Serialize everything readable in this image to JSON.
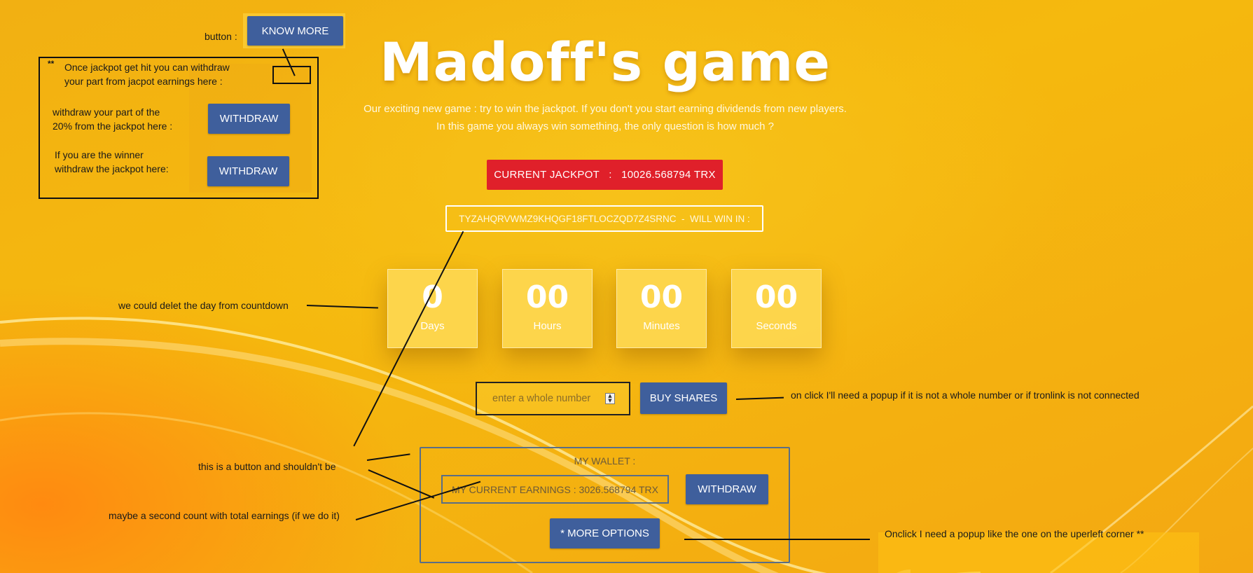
{
  "title": "Madoff's game",
  "subtitle": {
    "line1": "Our exciting new game : try to win the jackpot. If you don't you start earning dividends from new players.",
    "line2": "In this game you always win something, the only question is how much ?"
  },
  "jackpot": {
    "label": "CURRENT JACKPOT   :   10026.568794 TRX"
  },
  "winner": {
    "label": "TYZAHQRVWMZ9KHQGF18FTLOCZQD7Z4SRNC  -  WILL WIN IN :"
  },
  "countdown": [
    {
      "value": "0",
      "label": "Days"
    },
    {
      "value": "00",
      "label": "Hours"
    },
    {
      "value": "00",
      "label": "Minutes"
    },
    {
      "value": "00",
      "label": "Seconds"
    }
  ],
  "buy": {
    "placeholder": "enter a whole number",
    "button": "BUY SHARES"
  },
  "wallet": {
    "heading": "MY WALLET :",
    "earnings": "MY CURRENT EARNINGS : 3026.568794 TRX",
    "withdraw": "WITHDRAW",
    "more_options": "* MORE OPTIONS"
  },
  "top_left": {
    "button_note": "button :",
    "know_more": "KNOW MORE",
    "stars": "**",
    "jackpot_note_line1": "Once jackpot get hit you can withdraw",
    "jackpot_note_line2": "your part from jacpot earnings here :",
    "part_note_line1": "withdraw your part of the",
    "part_note_line2": "20% from the jackpot here :",
    "withdraw1": "WITHDRAW",
    "winner_note_line1": "If you are the winner",
    "winner_note_line2": "withdraw the jackpot here:",
    "withdraw2": "WITHDRAW"
  },
  "annotations": {
    "countdown_note": "we could delet the day from countdown",
    "popup_note": "on click I'll need a popup if it is not a whole number or if tronlink is not connected",
    "button_note": "this is a button and shouldn't be",
    "earnings_note": "maybe a second count with total earnings (if we do it)",
    "more_options_note": "Onclick I need a popup like the one on the uperleft corner **"
  }
}
